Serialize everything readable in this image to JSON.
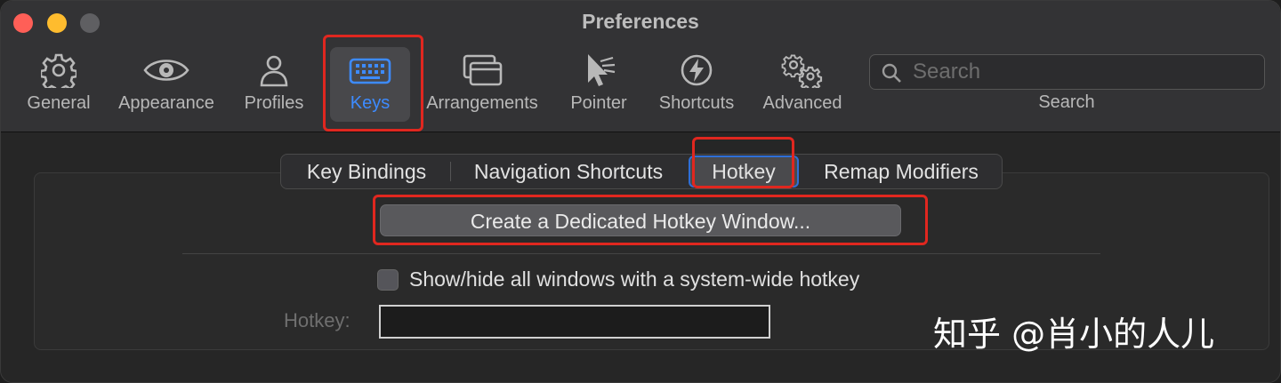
{
  "window": {
    "title": "Preferences"
  },
  "toolbar": {
    "items": [
      {
        "label": "General",
        "icon": "gear-icon"
      },
      {
        "label": "Appearance",
        "icon": "eye-icon"
      },
      {
        "label": "Profiles",
        "icon": "person-icon"
      },
      {
        "label": "Keys",
        "icon": "keyboard-icon",
        "selected": true
      },
      {
        "label": "Arrangements",
        "icon": "windows-icon"
      },
      {
        "label": "Pointer",
        "icon": "pointer-icon"
      },
      {
        "label": "Shortcuts",
        "icon": "bolt-icon"
      },
      {
        "label": "Advanced",
        "icon": "gears-icon"
      }
    ],
    "search": {
      "placeholder": "Search",
      "label": "Search"
    }
  },
  "tabs": [
    {
      "label": "Key Bindings"
    },
    {
      "label": "Navigation Shortcuts"
    },
    {
      "label": "Hotkey",
      "active": true
    },
    {
      "label": "Remap Modifiers"
    }
  ],
  "hotkey_pane": {
    "create_button_label": "Create a Dedicated Hotkey Window...",
    "checkbox_label": "Show/hide all windows with a system-wide hotkey",
    "checkbox_checked": false,
    "hotkey_label": "Hotkey:",
    "hotkey_value": ""
  },
  "watermark": "知乎 @肖小的人儿",
  "colors": {
    "accent": "#3d8bff",
    "highlight_annotation": "#e0271f",
    "close": "#ff5f57",
    "minimize": "#febc2e"
  }
}
